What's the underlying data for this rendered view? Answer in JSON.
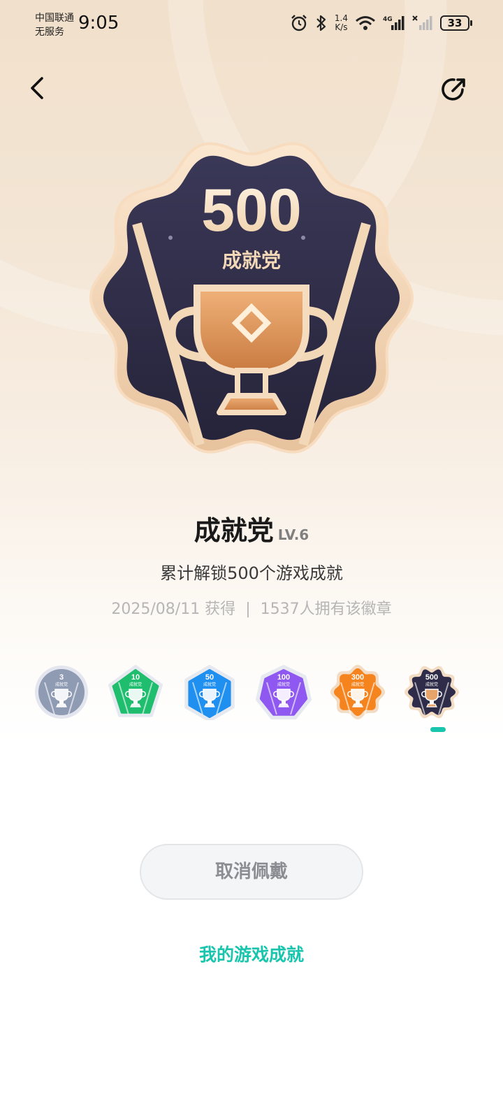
{
  "status_bar": {
    "carrier_line1": "中国联通",
    "carrier_line2": "无服务",
    "time": "9:05",
    "net_speed_value": "1.4",
    "net_speed_unit": "K/s",
    "network_type": "4G",
    "battery": "33",
    "icons": [
      "alarm-icon",
      "bluetooth-icon",
      "wifi-icon",
      "signal-icon",
      "signal-off-icon",
      "battery-icon"
    ]
  },
  "nav": {
    "back_icon": "chevron-left-icon",
    "share_icon": "share-icon"
  },
  "badge": {
    "number": "500",
    "name_on_badge": "成就党",
    "title": "成就党",
    "level": "LV.6",
    "description": "累计解锁500个游戏成就",
    "obtained": "2025/08/11 获得",
    "separator": "|",
    "owners": "1537人拥有该徽章"
  },
  "levels": [
    {
      "number": "3",
      "label": "成就党",
      "color": "#8f9bb3",
      "selected": false
    },
    {
      "number": "10",
      "label": "成就党",
      "color": "#1fbd6e",
      "selected": false
    },
    {
      "number": "50",
      "label": "成就党",
      "color": "#1f8ff0",
      "selected": false
    },
    {
      "number": "100",
      "label": "成就党",
      "color": "#8f58f0",
      "selected": false
    },
    {
      "number": "300",
      "label": "成就党",
      "color": "#f5841f",
      "selected": false
    },
    {
      "number": "500",
      "label": "成就党",
      "color": "#2e2c48",
      "selected": true
    }
  ],
  "actions": {
    "cancel_label": "取消佩戴",
    "my_achievements_label": "我的游戏成就"
  },
  "colors": {
    "accent": "#19c6ad",
    "badge_dark": "#2e2c48",
    "badge_gold": "#f0d2b0"
  }
}
